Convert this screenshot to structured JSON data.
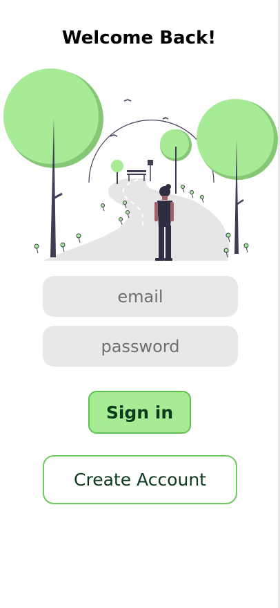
{
  "header": {
    "title": "Welcome Back!"
  },
  "login_form": {
    "email_placeholder": "email",
    "password_placeholder": "password",
    "sign_in_label": "Sign in",
    "create_account_label": "Create Account"
  },
  "illustration": {
    "icon": "park-path-person-illustration",
    "colors": {
      "tree_light": "#a8eb96",
      "tree_dark": "#86c777",
      "trunk": "#3f3d56",
      "path": "#e6e6e6"
    }
  },
  "theme": {
    "accent": "#a7ec94",
    "accent_border": "#5fbf50",
    "button_text": "#0d3a1f",
    "field_bg": "#e8e8e8"
  }
}
